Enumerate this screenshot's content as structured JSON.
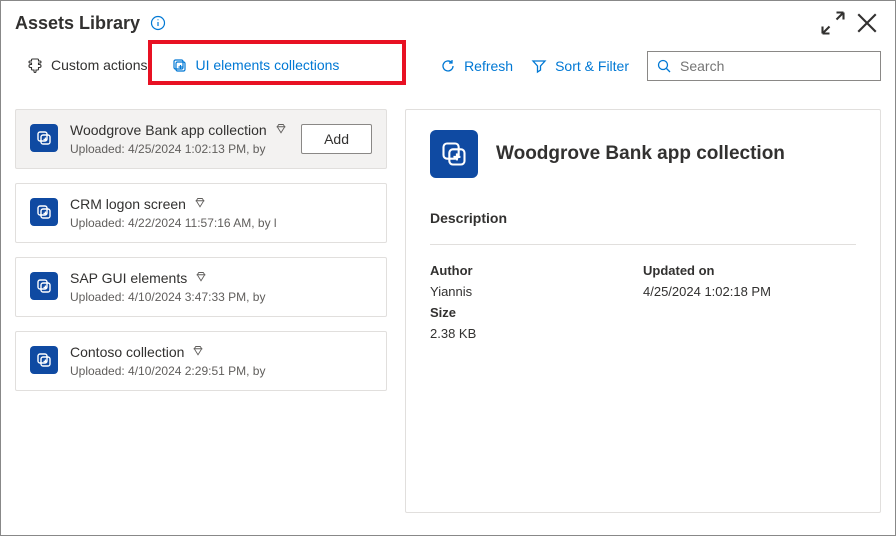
{
  "window": {
    "title": "Assets Library"
  },
  "tabs": {
    "custom_actions": "Custom actions",
    "ui_collections": "UI elements collections"
  },
  "toolbar": {
    "refresh": "Refresh",
    "sort_filter": "Sort & Filter",
    "search_placeholder": "Search"
  },
  "list": [
    {
      "title": "Woodgrove Bank app collection",
      "meta": "Uploaded: 4/25/2024 1:02:13 PM, by",
      "selected": true,
      "add": true
    },
    {
      "title": "CRM logon screen",
      "meta": "Uploaded: 4/22/2024 11:57:16 AM, by l",
      "selected": false,
      "add": false
    },
    {
      "title": "SAP GUI elements",
      "meta": "Uploaded: 4/10/2024 3:47:33 PM, by",
      "selected": false,
      "add": false
    },
    {
      "title": "Contoso collection",
      "meta": "Uploaded: 4/10/2024 2:29:51 PM, by",
      "selected": false,
      "add": false
    }
  ],
  "buttons": {
    "add": "Add"
  },
  "detail": {
    "title": "Woodgrove Bank app collection",
    "description_label": "Description",
    "author_label": "Author",
    "author_value": "Yiannis",
    "updated_label": "Updated on",
    "updated_value": "4/25/2024 1:02:18 PM",
    "size_label": "Size",
    "size_value": "2.38 KB"
  }
}
